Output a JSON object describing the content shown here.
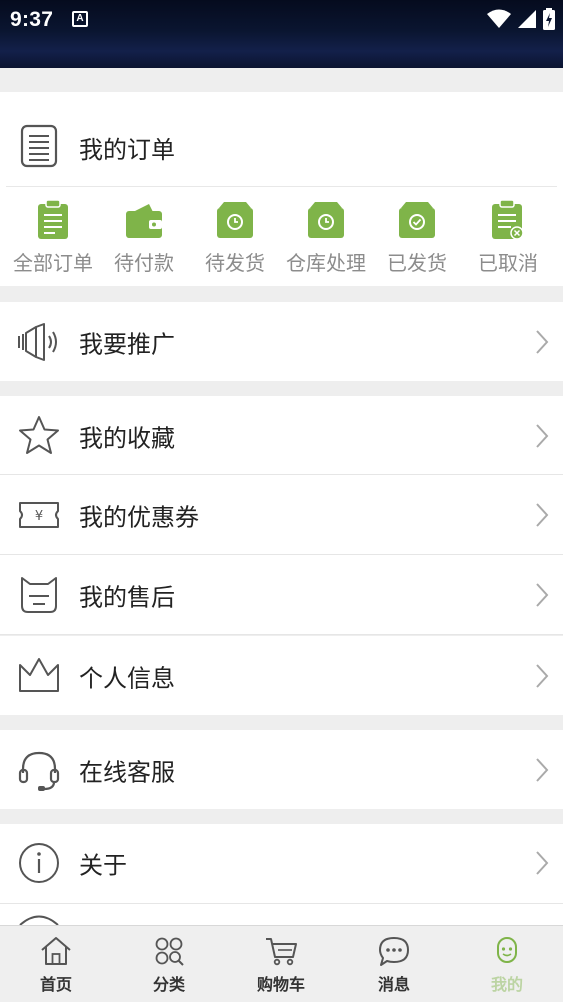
{
  "status_bar": {
    "time": "9:37",
    "notification_icon": "A"
  },
  "orders": {
    "title": "我的订单",
    "statuses": [
      {
        "label": "全部订单",
        "icon": "clipboard-list-icon"
      },
      {
        "label": "待付款",
        "icon": "wallet-icon"
      },
      {
        "label": "待发货",
        "icon": "box-clock-icon"
      },
      {
        "label": "仓库处理",
        "icon": "box-clock-icon"
      },
      {
        "label": "已发货",
        "icon": "box-check-icon"
      },
      {
        "label": "已取消",
        "icon": "clipboard-cancel-icon"
      }
    ]
  },
  "menu": {
    "promote": "我要推广",
    "favorites": "我的收藏",
    "coupons": "我的优惠券",
    "coupon_symbol": "¥",
    "after_sales": "我的售后",
    "profile": "个人信息",
    "support": "在线客服",
    "about": "关于"
  },
  "tabs": [
    {
      "label": "首页",
      "icon": "home-icon"
    },
    {
      "label": "分类",
      "icon": "category-icon"
    },
    {
      "label": "购物车",
      "icon": "cart-icon"
    },
    {
      "label": "消息",
      "icon": "message-icon"
    },
    {
      "label": "我的",
      "icon": "profile-icon"
    }
  ],
  "colors": {
    "accent_green": "#7fb449",
    "icon_gray": "#555555",
    "label_gray": "#8c8c8c"
  }
}
